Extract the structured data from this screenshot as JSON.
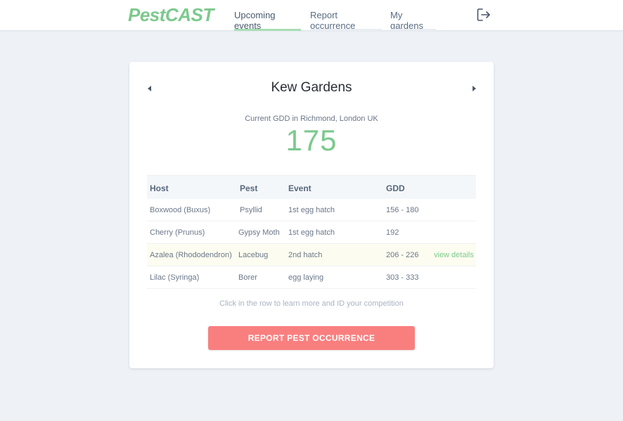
{
  "app": {
    "logo": "PestCAST"
  },
  "nav": {
    "tabs": [
      {
        "label": "Upcoming events",
        "active": true
      },
      {
        "label": "Report occurrence",
        "active": false
      },
      {
        "label": "My gardens",
        "active": false
      }
    ],
    "logout_icon": "logout-icon"
  },
  "garden": {
    "name": "Kew Gardens",
    "gdd_label": "Current GDD in Richmond, London UK",
    "gdd_value": "175"
  },
  "table": {
    "headers": {
      "host": "Host",
      "pest": "Pest",
      "event": "Event",
      "gdd": "GDD"
    },
    "rows": [
      {
        "host": "Boxwood (Buxus)",
        "pest": "Psyllid",
        "event": "1st egg hatch",
        "gdd": "156 - 180",
        "action": ""
      },
      {
        "host": "Cherry (Prunus)",
        "pest": "Gypsy Moth",
        "event": "1st egg hatch",
        "gdd": "192",
        "action": ""
      },
      {
        "host": "Azalea (Rhododendron)",
        "pest": "Lacebug",
        "event": "2nd hatch",
        "gdd": "206 - 226",
        "action": "view details"
      },
      {
        "host": "Lilac (Syringa)",
        "pest": "Borer",
        "event": "egg laying",
        "gdd": "303 - 333",
        "action": ""
      }
    ]
  },
  "hint": "Click in the row to learn more and ID your competition",
  "report_button": "REPORT PEST OCCURRENCE",
  "colors": {
    "accent_green": "#7cc98d",
    "button_red": "#f97f7f",
    "highlight_row": "#fcfdf0"
  }
}
